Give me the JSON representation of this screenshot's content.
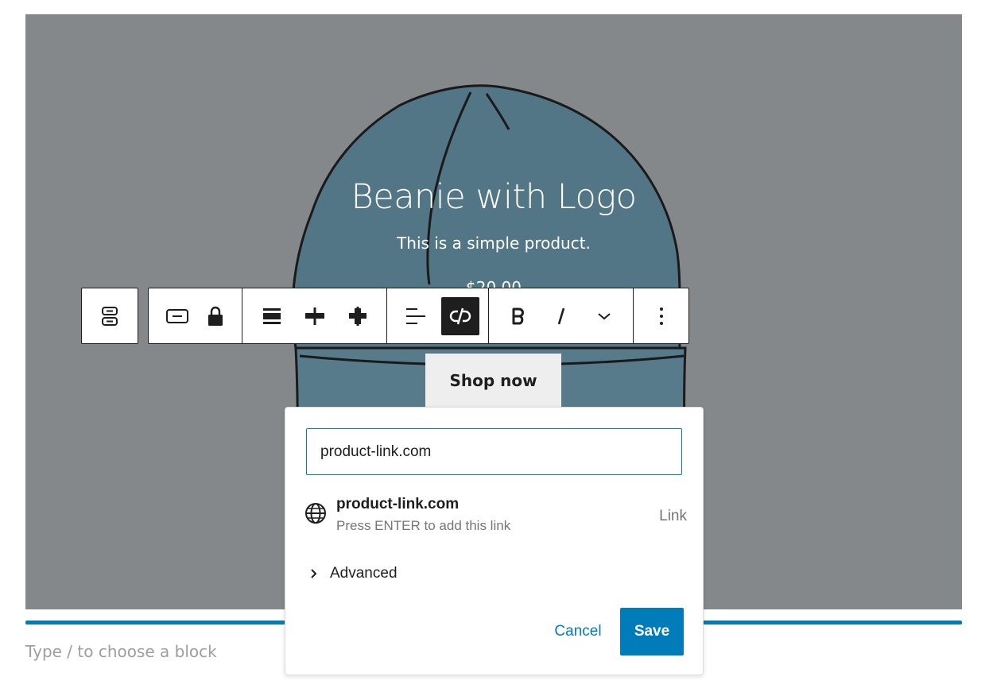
{
  "cover": {
    "title": "Beanie with Logo",
    "description": "This is a simple product.",
    "price": "$20.00",
    "background_color": "#85888b",
    "image_icon": "beanie-illustration"
  },
  "shop_button": {
    "label": "Shop now"
  },
  "block_toolbar": {
    "parent_selector_icon": "stack-icon",
    "groups": [
      [
        "button-icon",
        "lock-icon"
      ],
      [
        "justify-top-icon",
        "justify-center-icon",
        "justify-stretch-icon"
      ],
      [
        "align-left-icon",
        "unlink-icon"
      ],
      [
        "bold-icon",
        "italic-icon",
        "chevron-down-icon"
      ],
      [
        "more-options-icon"
      ]
    ]
  },
  "link_popover": {
    "url_value": "product-link.com",
    "suggestion": {
      "title": "product-link.com",
      "hint": "Press ENTER to add this link",
      "type": "Link",
      "icon": "globe-icon"
    },
    "advanced_label": "Advanced",
    "cancel_label": "Cancel",
    "save_label": "Save",
    "accent_color": "#007cba"
  },
  "appender": {
    "placeholder": "Type / to choose a block"
  }
}
